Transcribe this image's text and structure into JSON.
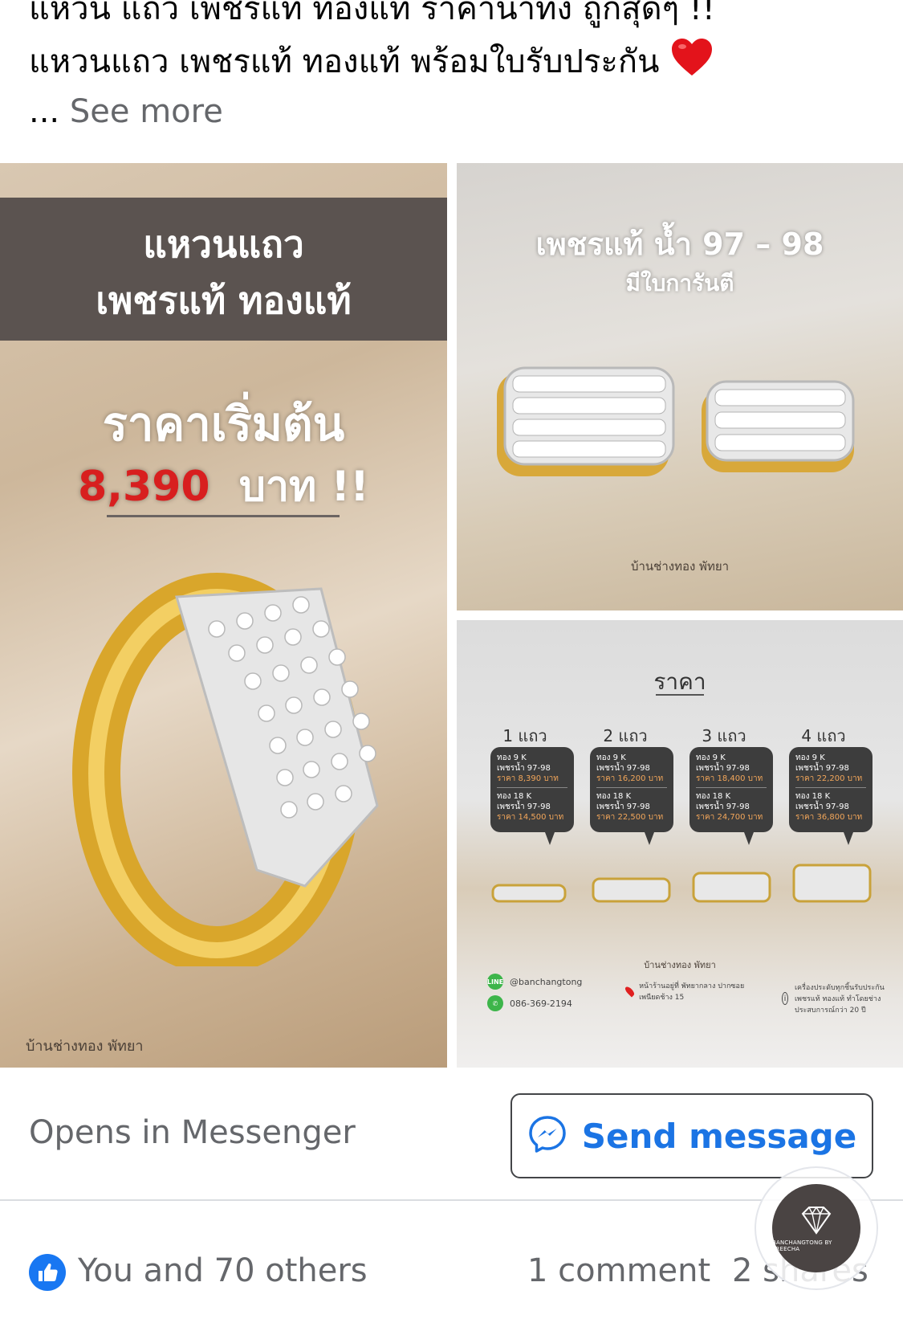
{
  "post": {
    "line1": "แหวน แถว เพชรแท้ ทองแท้ ราคาน่าทึ่ง ถูกสุดๆ !!",
    "line2": "แหวนแถว เพชรแท้ ทองแท้ พร้อมใบรับประกัน",
    "see_more_dots": "...",
    "see_more": "See more"
  },
  "images": {
    "left": {
      "banner_line1": "แหวนแถว",
      "banner_line2": "เพชรแท้ ทองแท้",
      "price_heading": "ราคาเริ่มต้น",
      "price_value": "8,390",
      "price_unit": "บาท !!",
      "watermark": "บ้านช่างทอง พัทยา"
    },
    "top_right": {
      "title": "เพชรแท้ น้ำ 97 – 98",
      "subtitle": "มีใบการันตี",
      "watermark": "บ้านช่างทอง พัทยา"
    },
    "bottom_right": {
      "title": "ราคา",
      "rows": [
        {
          "label": "1 แถว",
          "gold1": "ทอง 9 K",
          "diamond1": "เพชรน้ำ 97-98",
          "price1": "ราคา 8,390 บาท",
          "gold2": "ทอง 18 K",
          "diamond2": "เพชรน้ำ 97-98",
          "price2": "ราคา 14,500 บาท"
        },
        {
          "label": "2 แถว",
          "gold1": "ทอง 9 K",
          "diamond1": "เพชรน้ำ 97-98",
          "price1": "ราคา 16,200 บาท",
          "gold2": "ทอง 18 K",
          "diamond2": "เพชรน้ำ 97-98",
          "price2": "ราคา 22,500 บาท"
        },
        {
          "label": "3 แถว",
          "gold1": "ทอง 9 K",
          "diamond1": "เพชรน้ำ 97-98",
          "price1": "ราคา 18,400 บาท",
          "gold2": "ทอง 18 K",
          "diamond2": "เพชรน้ำ 97-98",
          "price2": "ราคา 24,700 บาท"
        },
        {
          "label": "4 แถว",
          "gold1": "ทอง 9 K",
          "diamond1": "เพชรน้ำ 97-98",
          "price1": "ราคา 22,200 บาท",
          "gold2": "ทอง 18 K",
          "diamond2": "เพชรน้ำ 97-98",
          "price2": "ราคา 36,800 บาท"
        }
      ],
      "shop_name": "บ้านช่างทอง พัทยา",
      "line_id": "@banchangtong",
      "phone": "086-369-2194",
      "address": "หน้าร้านอยู่ที่ พัทยากลาง ปากซอย เพนียดช้าง 15",
      "note": "เครื่องประดับทุกชิ้นรับประกัน เพชรแท้ ทองแท้ ทำโดยช่าง ประสบการณ์กว่า 20 ปี"
    }
  },
  "cta": {
    "opens_label": "Opens in Messenger",
    "send_label": "Send message"
  },
  "footer": {
    "reactions": "You and 70 others",
    "comments": "1 comment",
    "shares": "2 shares"
  },
  "avatar": {
    "text": "BANCHANGTONG BY PREECHA"
  },
  "colors": {
    "messenger_blue": "#1b74e4",
    "like_blue": "#1877f2",
    "price_red": "#d81f1f",
    "banner_brown": "#5b5350"
  }
}
